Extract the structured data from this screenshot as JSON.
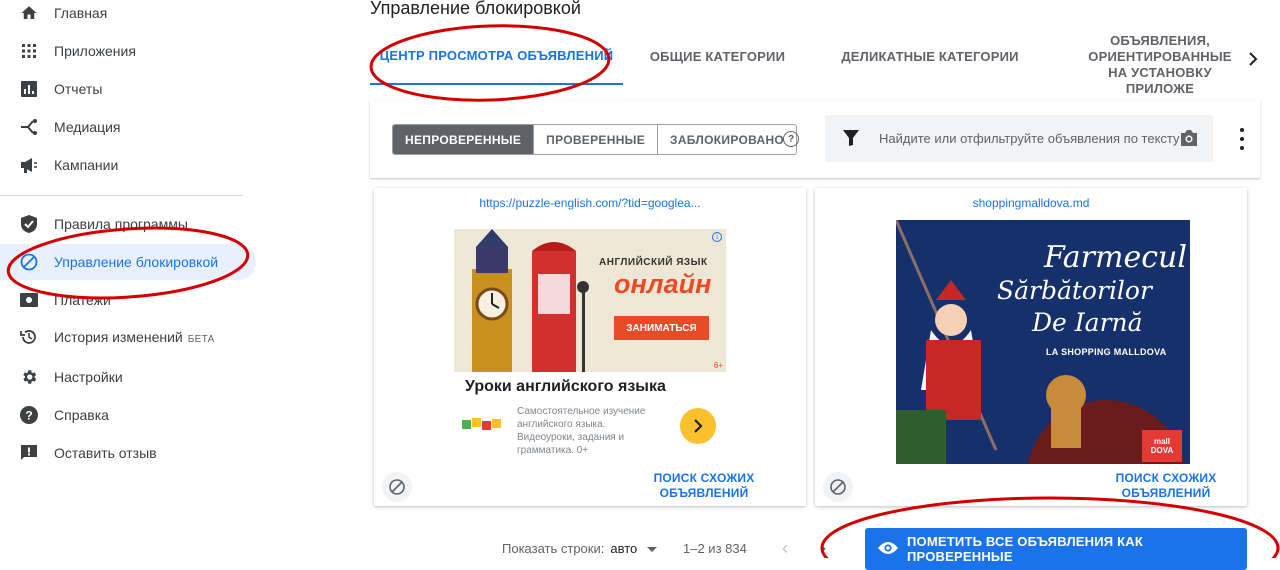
{
  "sidebar": {
    "items": [
      {
        "label": "Главная",
        "icon": "home-icon"
      },
      {
        "label": "Приложения",
        "icon": "apps-grid-icon"
      },
      {
        "label": "Отчеты",
        "icon": "bar-chart-icon"
      },
      {
        "label": "Медиация",
        "icon": "mediation-icon"
      },
      {
        "label": "Кампании",
        "icon": "megaphone-icon"
      },
      {
        "label": "Правила программы",
        "icon": "shield-icon"
      },
      {
        "label": "Управление блокировкой",
        "icon": "block-icon"
      },
      {
        "label": "Платежи",
        "icon": "payments-icon"
      },
      {
        "label": "История изменений",
        "icon": "history-icon",
        "badge": "БЕТА"
      },
      {
        "label": "Настройки",
        "icon": "gear-icon"
      },
      {
        "label": "Справка",
        "icon": "help-icon"
      },
      {
        "label": "Оставить отзыв",
        "icon": "feedback-icon"
      }
    ]
  },
  "page": {
    "title": "Управление блокировкой"
  },
  "tabs": [
    {
      "label": "ЦЕНТР ПРОСМОТРА ОБЪЯВЛЕНИЙ",
      "active": true
    },
    {
      "label": "ОБЩИЕ КАТЕГОРИИ"
    },
    {
      "label": "ДЕЛИКАТНЫЕ КАТЕГОРИИ"
    },
    {
      "label": "ОБЪЯВЛЕНИЯ, ОРИЕНТИРОВАННЫЕ НА УСТАНОВКУ ПРИЛОЖЕ"
    }
  ],
  "filters": {
    "segments": [
      "НЕПРОВЕРЕННЫЕ",
      "ПРОВЕРЕННЫЕ",
      "ЗАБЛОКИРОВАНО"
    ],
    "selected": "НЕПРОВЕРЕННЫЕ",
    "help": "?"
  },
  "search": {
    "placeholder": "Найдите или отфильтруйте объявления по тексту"
  },
  "cards": [
    {
      "url": "https://puzzle-english.com/?tid=googlea...",
      "creative": {
        "line1": "АНГЛИЙСКИЙ ЯЗЫК",
        "line2": "онлайн",
        "cta": "ЗАНИМАТЬСЯ",
        "age": "6+",
        "info": "i"
      },
      "headline": "Уроки английского языка",
      "description": "Самостоятельное изучение английского языка. Видеоуроки, задания и грамматика. 0+",
      "similar": "ПОИСК СХОЖИХ ОБЪЯВЛЕНИЙ"
    },
    {
      "url": "shoppingmalldova.md",
      "creative": {
        "line1": "Farmecul",
        "line2": "Sărbătorilor",
        "line3": "De Iarnă",
        "line4": "LA SHOPPING MALLDOVA",
        "logo": "mall DOVA"
      },
      "similar": "ПОИСК СХОЖИХ ОБЪЯВЛЕНИЙ"
    }
  ],
  "footer": {
    "rows_label": "Показать строки:",
    "rows_value": "авто",
    "range": "1–2 из 834",
    "mark_all": "ПОМЕТИТЬ ВСЕ ОБЪЯВЛЕНИЯ КАК ПРОВЕРЕННЫЕ"
  },
  "colors": {
    "accent": "#1a73e8",
    "annotation": "#d40000",
    "active_nav_bg": "#e8f0fe"
  }
}
